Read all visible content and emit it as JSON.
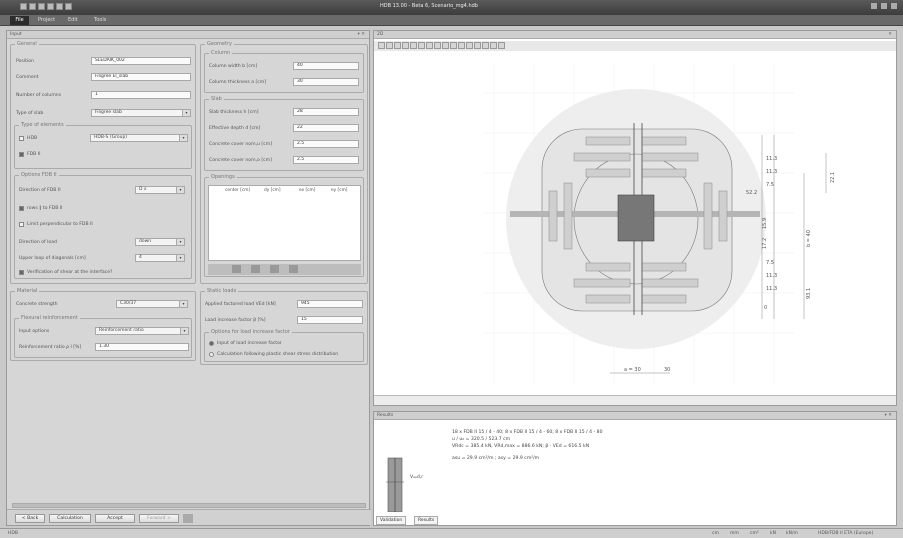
{
  "window": {
    "title": "HDB 13.00 - Beta 6, Scenario_mg4.hdb"
  },
  "ribbon": {
    "file": "File",
    "tabs": [
      "Project",
      "Edit",
      "Tools"
    ]
  },
  "input_pane": {
    "title": "Input",
    "general": {
      "title": "General",
      "position_label": "Position",
      "position_value": "SLEDAIK_002",
      "comment_label": "Comment",
      "comment_value": "Filigree El_slab",
      "columns_label": "Number of columns",
      "columns_value": "1",
      "slabtype_label": "Type of slab",
      "slabtype_value": "Filigree slab",
      "elements_title": "Type of elements",
      "hdb_label": "HDB",
      "hdb_value": "HDB-S (Group)",
      "fdbii_label": "FDB II",
      "options_title": "Options FDB II",
      "direction_label": "Direction of FDB II",
      "direction_value": "D x",
      "rows_label": "rows ∥ to FDB II",
      "limit_label": "Limit perpendicular to FDB II",
      "load_dir_label": "Direction of load",
      "load_dir_value": "down",
      "upper_label": "Upper loop of diagonals [cm]",
      "upper_value": "4",
      "verif_label": "Verification of shear at the interface?"
    },
    "geometry": {
      "title": "Geometry",
      "column_title": "Column",
      "col_width_label": "Column width  b [cm]",
      "col_width_value": "40",
      "col_thick_label": "Column thickness  a [cm]",
      "col_thick_value": "30",
      "slab_title": "Slab",
      "slab_thick_label": "Slab thickness  h [cm]",
      "slab_thick_value": "28",
      "eff_depth_label": "Effective depth  d [cm]",
      "eff_depth_value": "22",
      "cover_u_label": "Concrete cover  nom,u [cm]",
      "cover_u_value": "2.5",
      "cover_o_label": "Concrete cover  nom,o [cm]",
      "cover_o_value": "2.5",
      "openings_title": "Openings",
      "openings_cols": [
        "center [cm]",
        "dy [cm]",
        "ex [cm]",
        "ey [cm]"
      ]
    },
    "material": {
      "title": "Material",
      "strength_label": "Concrete strength",
      "strength_value": "C30/37",
      "flex_title": "Flexural reinforcement",
      "input_opt_label": "Input options",
      "input_opt_value": "Reinforcement ratio",
      "ratio_label": "Reinforcement ratio  ρ l [%]",
      "ratio_value": "1.30"
    },
    "static": {
      "title": "Static loads",
      "applied_label": "Applied factored load  VEd [kN]",
      "applied_value": "945",
      "increase_label": "Load increase factor  β [%]",
      "increase_value": "15",
      "options_title": "Options for load increase factor",
      "opt1": "Input of load increase factor",
      "opt2": "Calculation following plastic shear stress distribution"
    },
    "buttons": {
      "back": "< Back",
      "calc": "Calculation",
      "accept": "Accept",
      "forward": "Forward >"
    }
  },
  "view3d": {
    "title": "2D",
    "dims": [
      "11.3",
      "11.3",
      "7.5",
      "11.3",
      "11.3",
      "7.5",
      "17.2",
      "15.9",
      "22.1",
      "52.2",
      "b = 40",
      "93.1",
      "0"
    ],
    "bottom_dims": [
      "a = 30",
      "30"
    ]
  },
  "results": {
    "title": "Results",
    "lines": [
      "18 x FDB II 15 / 4 - 40; 8 x FDB II 15 / 4 - 60; 8 x FDB II 15 / 4 - 80",
      "u / u₀ = 320.5 / 523.7 cm",
      "VRdc = 385.4 kN, VRd,max = 886.6 kN; β · VEd = 616.5 kN",
      "asu = 29.9 cm²/m ; asy = 29.9 cm²/m"
    ],
    "vlabel": "Vₐₑd,r",
    "tabs": [
      "Validation",
      "Results"
    ]
  },
  "status": {
    "left": "HDB",
    "items": [
      "cm",
      "mm",
      "cm²",
      "kN",
      "kN/m",
      "HDB/FDB II  ETA (Europe)"
    ]
  }
}
